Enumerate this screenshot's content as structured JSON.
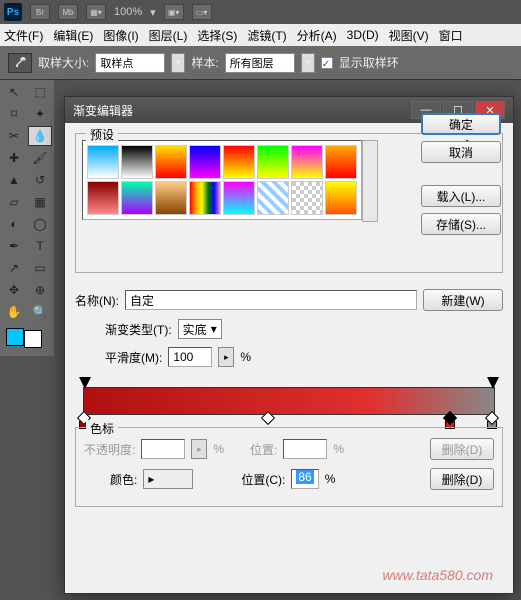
{
  "header": {
    "zoom": "100%"
  },
  "menu": {
    "file": "文件(F)",
    "edit": "编辑(E)",
    "image": "图像(I)",
    "layer": "图层(L)",
    "select": "选择(S)",
    "filter": "滤镜(T)",
    "analyze": "分析(A)",
    "threeD": "3D(D)",
    "view": "视图(V)",
    "window": "窗口"
  },
  "optbar": {
    "sample_size_label": "取样大小:",
    "sample_size_value": "取样点",
    "sample_label": "样本:",
    "sample_value": "所有图层",
    "show_ring": "显示取样环"
  },
  "dialog": {
    "title": "渐变编辑器",
    "presets_label": "预设",
    "buttons": {
      "ok": "确定",
      "cancel": "取消",
      "load": "载入(L)...",
      "save": "存储(S)...",
      "new": "新建(W)"
    },
    "name_label": "名称(N):",
    "name_value": "自定",
    "type_label": "渐变类型(T):",
    "type_value": "实底",
    "smooth_label": "平滑度(M):",
    "smooth_value": "100",
    "percent": "%",
    "stops": {
      "legend": "色标",
      "opacity_label": "不透明度:",
      "opacity_value": "",
      "pos_label": "位置:",
      "pos_value": "",
      "delete_btn": "删除(D)",
      "color_label": "颜色:",
      "pos2_label": "位置(C):",
      "pos2_value": "86",
      "delete2_btn": "删除(D)"
    }
  },
  "watermark": "www.tata580.com"
}
